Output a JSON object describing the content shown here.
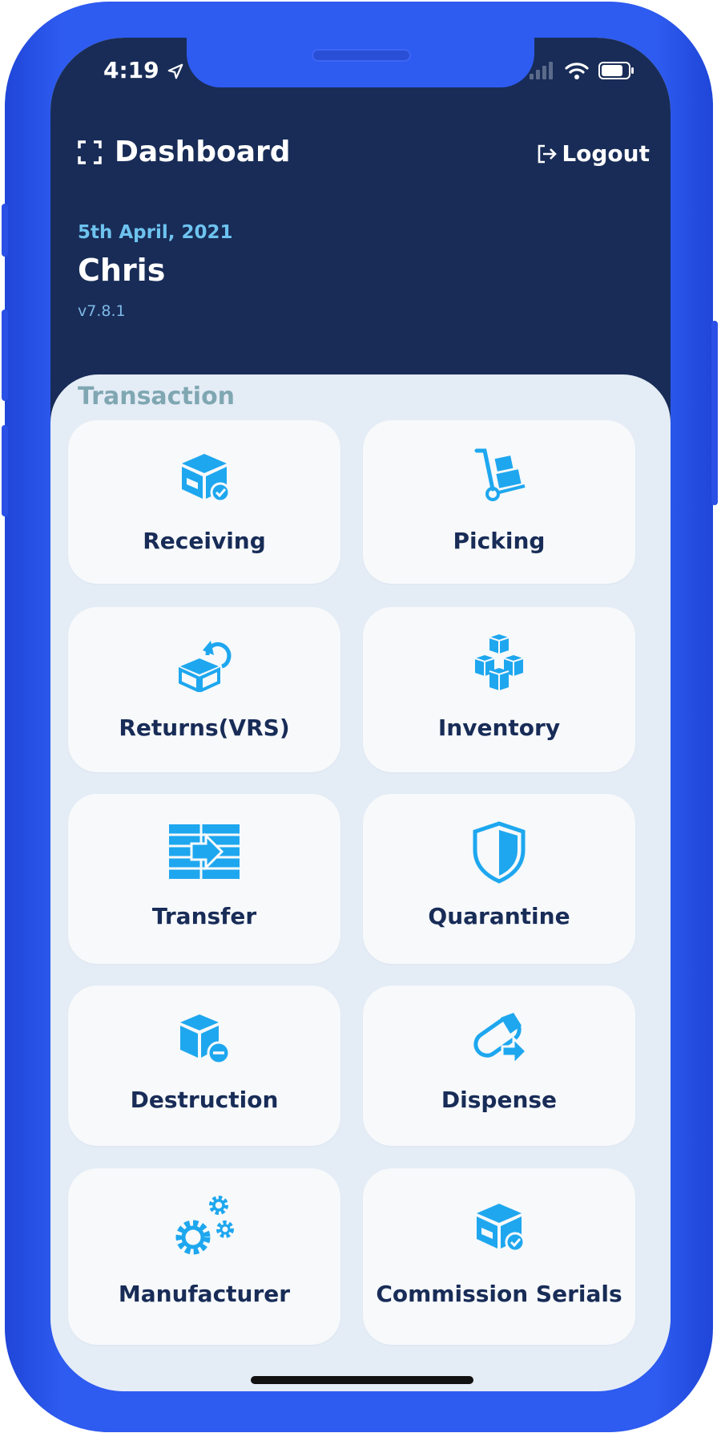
{
  "status_bar": {
    "time": "4:19"
  },
  "header": {
    "title": "Dashboard",
    "logout_label": "Logout",
    "date": "5th April, 2021",
    "user_name": "Chris",
    "version": "v7.8.1"
  },
  "section_title": "Transaction",
  "tiles": [
    {
      "label": "Receiving",
      "icon": "box-check-icon"
    },
    {
      "label": "Picking",
      "icon": "hand-truck-icon"
    },
    {
      "label": "Returns(VRS)",
      "icon": "box-return-icon"
    },
    {
      "label": "Inventory",
      "icon": "stacked-boxes-icon"
    },
    {
      "label": "Transfer",
      "icon": "transfer-arrow-icon"
    },
    {
      "label": "Quarantine",
      "icon": "shield-icon"
    },
    {
      "label": "Destruction",
      "icon": "box-minus-icon"
    },
    {
      "label": "Dispense",
      "icon": "pill-arrow-icon"
    },
    {
      "label": "Manufacturer",
      "icon": "gears-icon"
    },
    {
      "label": "Commission Serials",
      "icon": "box-check-icon"
    }
  ],
  "colors": {
    "frame": "#2e5bf0",
    "header_bg": "#182c57",
    "panel_bg": "#e4ecf6",
    "tile_bg": "#f7f9fb",
    "icon": "#1ea7ef",
    "label": "#182c57",
    "date": "#6ec3ef",
    "section": "#7fa7b2"
  }
}
